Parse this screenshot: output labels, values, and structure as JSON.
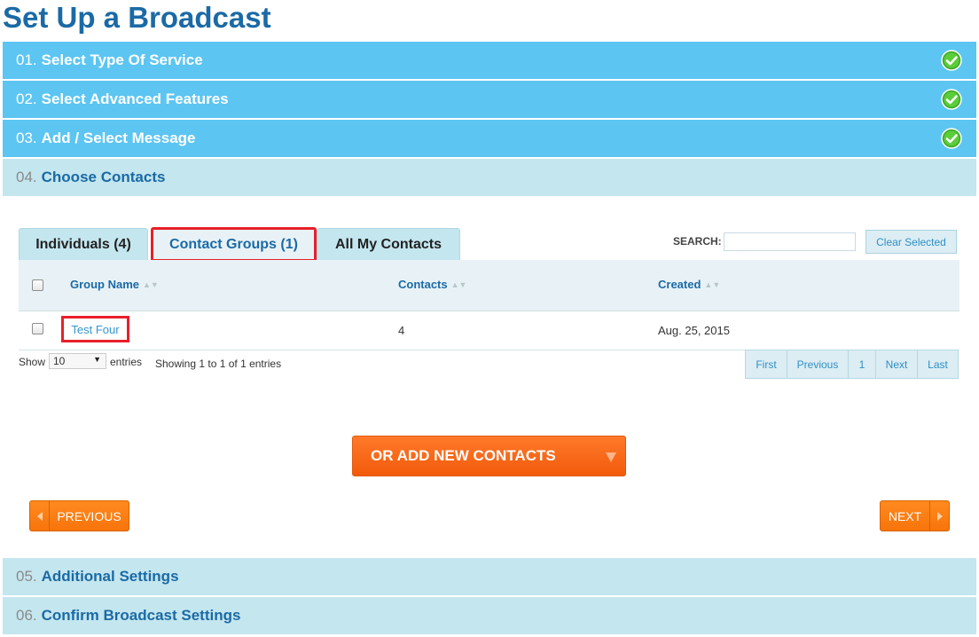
{
  "page_title": "Set Up a Broadcast",
  "steps": [
    {
      "num": "01.",
      "label": "Select Type Of Service",
      "state": "done"
    },
    {
      "num": "02.",
      "label": "Select Advanced Features",
      "state": "done"
    },
    {
      "num": "03.",
      "label": "Add / Select Message",
      "state": "done"
    },
    {
      "num": "04.",
      "label": "Choose Contacts",
      "state": "current"
    },
    {
      "num": "05.",
      "label": "Additional Settings",
      "state": "pending"
    },
    {
      "num": "06.",
      "label": "Confirm Broadcast Settings",
      "state": "pending"
    }
  ],
  "tabs": [
    {
      "label": "Individuals (4)"
    },
    {
      "label": "Contact Groups (1)",
      "active": true
    },
    {
      "label": "All My Contacts"
    }
  ],
  "search": {
    "label": "SEARCH:",
    "value": "",
    "placeholder": ""
  },
  "clear_selected": "Clear Selected",
  "table": {
    "columns": [
      "Group Name",
      "Contacts",
      "Created"
    ],
    "rows": [
      {
        "name": "Test Four",
        "contacts": "4",
        "created": "Aug. 25, 2015"
      }
    ]
  },
  "length": {
    "show": "Show",
    "value": "10",
    "entries": "entries"
  },
  "info": "Showing 1 to 1 of 1 entries",
  "pager": [
    "First",
    "Previous",
    "1",
    "Next",
    "Last"
  ],
  "add_contacts": "OR ADD NEW CONTACTS",
  "previous": "PREVIOUS",
  "next": "NEXT",
  "colors": {
    "done": "#5cc5f2",
    "pending": "#c4e6ef",
    "accent": "#f25a0b",
    "highlight": "#e8202a"
  }
}
